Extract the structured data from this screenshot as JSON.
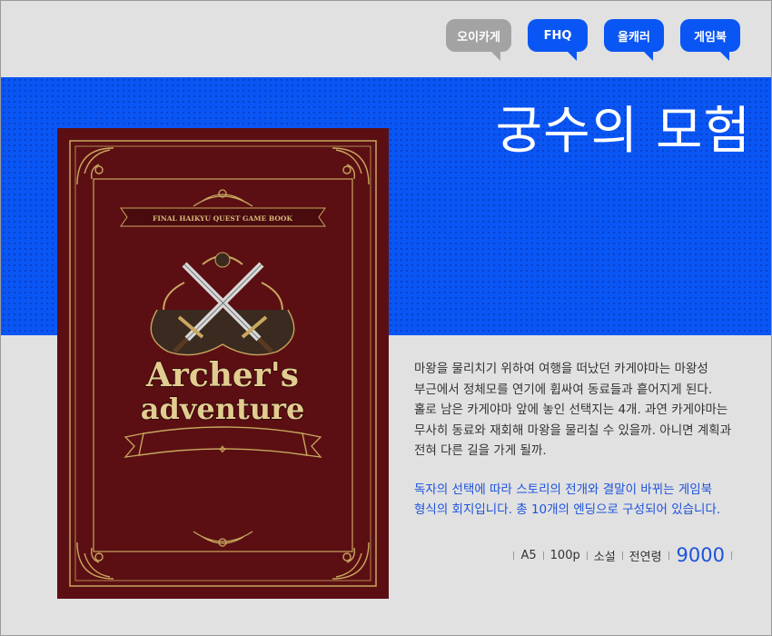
{
  "tags": [
    "오이카게",
    "FHQ",
    "올캐러",
    "게임북"
  ],
  "colors": {
    "accent": "#0a56f5",
    "tag_gray": "#a3a3a3",
    "book": "#5b0f13",
    "gold": "#c8a75f",
    "highlight": "#1d52dc"
  },
  "title": "궁수의 모험",
  "book_cover": {
    "subtitle": "FINAL HAIKYU QUEST GAME BOOK",
    "title_line1": "Archer's",
    "title_line2": "adventure",
    "emblem": "crossed-swords-icon"
  },
  "description": {
    "lines1": [
      "마왕을 물리치기 위하여 여행을 떠났던 카게야마는 마왕성",
      "부근에서 정체모를 연기에 휩싸여 동료들과 흩어지게 된다.",
      "홀로 남은 카게야마 앞에 놓인 선택지는 4개. 과연 카게야마는",
      "무사히 동료와 재회해 마왕을 물리칠 수 있을까. 아니면 계획과",
      "전혀 다른 길을 가게 될까."
    ],
    "lines2": [
      "독자의 선택에 따라 스토리의 전개와 결말이 바뀌는 게임북",
      "형식의 회지입니다. 총 10개의 엔딩으로 구성되어 있습니다."
    ]
  },
  "meta": {
    "size": "A5",
    "pages": "100p",
    "genre": "소설",
    "rating": "전연령",
    "price": "9000"
  }
}
